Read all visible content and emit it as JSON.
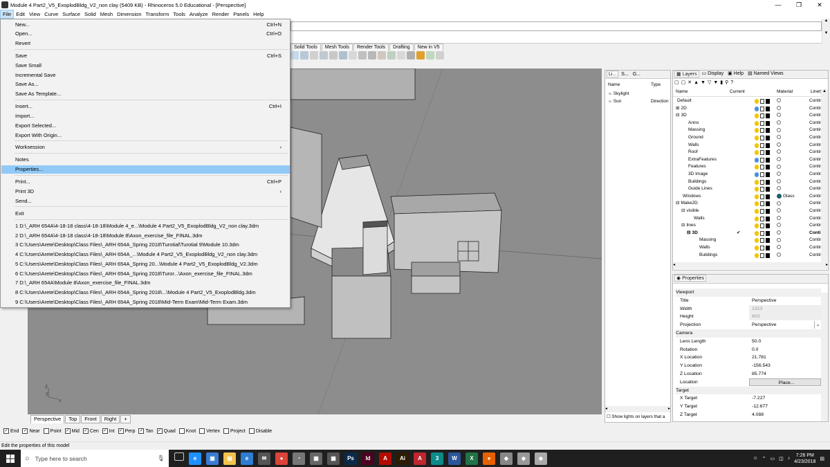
{
  "window": {
    "title": "Module 4 Part2_V5_ExoplodBldg_V2_non clay (5409 KB) - Rhinoceros 5.0 Educational - [Perspective]"
  },
  "menubar": [
    "File",
    "Edit",
    "View",
    "Curve",
    "Surface",
    "Solid",
    "Mesh",
    "Dimension",
    "Transform",
    "Tools",
    "Analyze",
    "Render",
    "Panels",
    "Help"
  ],
  "file_menu": {
    "new": "New...",
    "new_sc": "Ctrl+N",
    "open": "Open...",
    "open_sc": "Ctrl+O",
    "revert": "Revert",
    "save": "Save",
    "save_sc": "Ctrl+S",
    "save_small": "Save Small",
    "incremental_save": "Incremental Save",
    "save_as": "Save As...",
    "save_as_template": "Save As Template...",
    "insert": "Insert...",
    "insert_sc": "Ctrl+I",
    "import": "Import...",
    "export_selected": "Export Selected...",
    "export_with_origin": "Export With Origin...",
    "worksession": "Worksession",
    "notes": "Notes",
    "properties": "Properties...",
    "print": "Print...",
    "print_sc": "Ctrl+P",
    "print3d": "Print 3D",
    "send": "Send...",
    "exit": "Exit",
    "recent": [
      "1 D:\\_ARH 654A\\4-18-18 class\\4-18-18\\Module 4_e...\\Module 4 Part2_V5_ExoplodBldg_V2_non clay.3dm",
      "2 D:\\_ARH 654A\\4-18-18 class\\4-18-18\\Module 8\\Axon_exercise_file_FINAL.3dm",
      "3 C:\\Users\\Arete\\Desktop\\Class Files\\_ARH 654A_Spring 2018\\Turotial\\Turotial 9\\Module 10.3dm",
      "4 C:\\Users\\Arete\\Desktop\\Class Files\\_ARH 654A_...\\Module 4 Part2_V5_ExoplodBldg_V2_non clay.3dm",
      "5 C:\\Users\\Arete\\Desktop\\Class Files\\_ARH 654A_Spring 20...\\Module 4 Part2_V5_ExoplodBldg_V2.3dm",
      "6 C:\\Users\\Arete\\Desktop\\Class Files\\_ARH 654A_Spring 2018\\Turor...\\Axon_exercise_file_FINAL.3dm",
      "7 D:\\_ARH 654A\\Module 8\\Axon_exercise_file_FINAL.3dm",
      "8 C:\\Users\\Arete\\Desktop\\Class Files\\_ARH 654A_Spring 2018\\...\\Module 4 Part2_V5_ExoplodBldg.3dm",
      "9 C:\\Users\\Arete\\Desktop\\Class Files\\_ARH 654A_Spring 2018\\Mid-Term Exam\\Mid-Term Exam.3dm"
    ]
  },
  "tool_tabs": [
    "Solid Tools",
    "Mesh Tools",
    "Render Tools",
    "Drafting",
    "New in V5"
  ],
  "viewport_tabs": [
    "Perspective",
    "Top",
    "Front",
    "Right"
  ],
  "viewport_add": "+",
  "osnaps": [
    {
      "label": "End",
      "checked": true
    },
    {
      "label": "Near",
      "checked": true
    },
    {
      "label": "Point",
      "checked": false
    },
    {
      "label": "Mid",
      "checked": true
    },
    {
      "label": "Cen",
      "checked": true
    },
    {
      "label": "Int",
      "checked": true
    },
    {
      "label": "Perp",
      "checked": true
    },
    {
      "label": "Tan",
      "checked": true
    },
    {
      "label": "Quad",
      "checked": true
    },
    {
      "label": "Knot",
      "checked": false
    },
    {
      "label": "Vertex",
      "checked": false
    },
    {
      "label": "Project",
      "checked": false
    },
    {
      "label": "Disable",
      "checked": false
    }
  ],
  "status_text": "Edit the properties of this model",
  "lights_panel": {
    "tabs": [
      "Li...",
      "S...",
      "G..."
    ],
    "col_name": "Name",
    "col_type": "Type",
    "rows": [
      {
        "name": "Skylight",
        "type": ""
      },
      {
        "name": "Sun",
        "type": "Direction"
      }
    ],
    "footer": "Show lights on layers that a"
  },
  "layers_panel": {
    "tabs": [
      "Layers",
      "Display",
      "Help",
      "Named Views"
    ],
    "col_name": "Name",
    "col_current": "Current",
    "col_material": "Material",
    "col_linetype": "Linety",
    "rows": [
      {
        "name": "Default",
        "indent": 0,
        "exp": "",
        "mat": "",
        "lt": "Contin",
        "bold": false
      },
      {
        "name": "2D",
        "indent": 0,
        "exp": "⊞",
        "mat": "",
        "lt": "Contin",
        "bold": false
      },
      {
        "name": "3D",
        "indent": 0,
        "exp": "⊟",
        "mat": "",
        "lt": "Contin",
        "bold": false
      },
      {
        "name": "Anno",
        "indent": 2,
        "exp": "",
        "mat": "",
        "lt": "Contin",
        "bold": false
      },
      {
        "name": "Massing",
        "indent": 2,
        "exp": "",
        "mat": "",
        "lt": "Contin",
        "bold": false
      },
      {
        "name": "Ground",
        "indent": 2,
        "exp": "",
        "mat": "",
        "lt": "Contin",
        "bold": false
      },
      {
        "name": "Walls",
        "indent": 2,
        "exp": "",
        "mat": "",
        "lt": "Contin",
        "bold": false
      },
      {
        "name": "Roof",
        "indent": 2,
        "exp": "",
        "mat": "",
        "lt": "Contin",
        "bold": false
      },
      {
        "name": "ExtraFeatures",
        "indent": 2,
        "exp": "",
        "mat": "",
        "lt": "Contin",
        "bold": false
      },
      {
        "name": "Features",
        "indent": 2,
        "exp": "",
        "mat": "",
        "lt": "Contin",
        "bold": false
      },
      {
        "name": "3D Image",
        "indent": 2,
        "exp": "",
        "mat": "",
        "lt": "Contin",
        "bold": false
      },
      {
        "name": "Buildings",
        "indent": 2,
        "exp": "",
        "mat": "",
        "lt": "Contin",
        "bold": false
      },
      {
        "name": "Guide Lines",
        "indent": 2,
        "exp": "",
        "mat": "",
        "lt": "Contin",
        "bold": false
      },
      {
        "name": "Windows",
        "indent": 1,
        "exp": "",
        "mat": "Glass",
        "lt": "Contin",
        "bold": false
      },
      {
        "name": "Make2D",
        "indent": 0,
        "exp": "⊟",
        "mat": "",
        "lt": "Contin",
        "bold": false
      },
      {
        "name": "visible",
        "indent": 1,
        "exp": "⊟",
        "mat": "",
        "lt": "Contin",
        "bold": false
      },
      {
        "name": "Walls",
        "indent": 3,
        "exp": "",
        "mat": "",
        "lt": "Contin",
        "bold": false
      },
      {
        "name": "lines",
        "indent": 1,
        "exp": "⊟",
        "mat": "",
        "lt": "Contin",
        "bold": false
      },
      {
        "name": "3D",
        "indent": 2,
        "exp": "⊟",
        "mat": "",
        "lt": "Conti",
        "bold": true,
        "current": "✔"
      },
      {
        "name": "Massing",
        "indent": 4,
        "exp": "",
        "mat": "",
        "lt": "Contin",
        "bold": false
      },
      {
        "name": "Walls",
        "indent": 4,
        "exp": "",
        "mat": "",
        "lt": "Contin",
        "bold": false
      },
      {
        "name": "Buildings",
        "indent": 4,
        "exp": "",
        "mat": "",
        "lt": "Contin",
        "bold": false
      }
    ]
  },
  "properties_panel": {
    "tab": "Properties",
    "rows": [
      {
        "key": "Viewport",
        "val": "",
        "hdr": true
      },
      {
        "key": "Title",
        "val": "Perspective"
      },
      {
        "key": "Width",
        "val": "1323",
        "dim": true
      },
      {
        "key": "Height",
        "val": "803",
        "dim": true
      },
      {
        "key": "Projection",
        "val": "Perspective",
        "dd": true
      },
      {
        "key": "Camera",
        "val": "",
        "hdr": true
      },
      {
        "key": "Lens Length",
        "val": "50.0"
      },
      {
        "key": "Rotation",
        "val": "0.0"
      },
      {
        "key": "X Location",
        "val": "21.781"
      },
      {
        "key": "Y Location",
        "val": "-156.543"
      },
      {
        "key": "Z Location",
        "val": "85.774"
      },
      {
        "key": "Location",
        "val": "Place...",
        "btn": true
      },
      {
        "key": "Target",
        "val": "",
        "hdr": true
      },
      {
        "key": "X Target",
        "val": "-7.227"
      },
      {
        "key": "Y Target",
        "val": "-12.677"
      },
      {
        "key": "Z Target",
        "val": "4.088"
      }
    ]
  },
  "taskbar": {
    "search_placeholder": "Type here to search",
    "clock_time": "7:26 PM",
    "clock_date": "4/23/2018",
    "apps": [
      {
        "label": "e",
        "color": "#1e90ff",
        "name": "edge-icon"
      },
      {
        "label": "▣",
        "color": "#3a7bd5",
        "name": "store-icon"
      },
      {
        "label": "▤",
        "color": "#f2c14e",
        "name": "file-explorer-icon"
      },
      {
        "label": "e",
        "color": "#2d7dd2",
        "name": "ie-icon"
      },
      {
        "label": "✉",
        "color": "#555",
        "name": "mail-icon"
      },
      {
        "label": "●",
        "color": "#db4437",
        "name": "chrome-icon"
      },
      {
        "label": "◔",
        "color": "#777",
        "name": "app-icon"
      },
      {
        "label": "▦",
        "color": "#666",
        "name": "calendar-icon"
      },
      {
        "label": "▦",
        "color": "#555",
        "name": "calculator-icon"
      },
      {
        "label": "Ps",
        "color": "#0b2a4a",
        "name": "photoshop-icon"
      },
      {
        "label": "Id",
        "color": "#49021f",
        "name": "indesign-icon"
      },
      {
        "label": "A",
        "color": "#b30b00",
        "name": "acrobat-icon"
      },
      {
        "label": "Ai",
        "color": "#2d1b00",
        "name": "illustrator-icon"
      },
      {
        "label": "A",
        "color": "#c0262d",
        "name": "autocad-icon"
      },
      {
        "label": "3",
        "color": "#0c8a8a",
        "name": "3ds-icon"
      },
      {
        "label": "W",
        "color": "#2b579a",
        "name": "word-icon"
      },
      {
        "label": "X",
        "color": "#217346",
        "name": "excel-icon"
      },
      {
        "label": "●",
        "color": "#e66000",
        "name": "firefox-icon"
      },
      {
        "label": "◆",
        "color": "#888",
        "name": "rhino-icon"
      },
      {
        "label": "◆",
        "color": "#999",
        "name": "rhino2-icon"
      },
      {
        "label": "◆",
        "color": "#aaa",
        "name": "rhino3-icon"
      }
    ]
  },
  "colors": {
    "menu_highlight": "#91c9f7",
    "viewport_bg": "#8d8d8d",
    "taskbar": "#1f1f1f"
  }
}
